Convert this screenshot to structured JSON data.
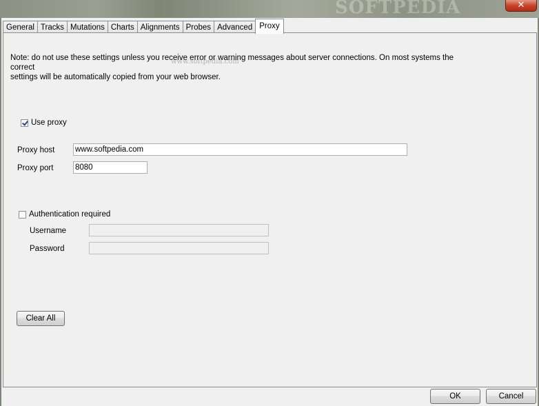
{
  "window": {
    "watermark": "SOFTPEDIA",
    "watermark_url": "www.softpedia.com",
    "close_glyph": "✕"
  },
  "tabs": [
    {
      "label": "General"
    },
    {
      "label": "Tracks"
    },
    {
      "label": "Mutations"
    },
    {
      "label": "Charts"
    },
    {
      "label": "Alignments"
    },
    {
      "label": "Probes"
    },
    {
      "label": "Advanced"
    },
    {
      "label": "Proxy",
      "active": true
    }
  ],
  "proxy": {
    "note_line1": "Note: do not use these settings unless you receive error or warning messages about server connections. On most systems the correct",
    "note_line2": "settings will be automatically copied from your web browser.",
    "use_proxy_label": "Use proxy",
    "use_proxy_checked": true,
    "host_label": "Proxy host",
    "host_value": "www.softpedia.com",
    "port_label": "Proxy port",
    "port_value": "8080",
    "auth_label": "Authentication required",
    "auth_checked": false,
    "username_label": "Username",
    "username_value": "",
    "password_label": "Password",
    "password_value": "",
    "clear_all_label": "Clear All"
  },
  "footer": {
    "ok_label": "OK",
    "cancel_label": "Cancel"
  }
}
